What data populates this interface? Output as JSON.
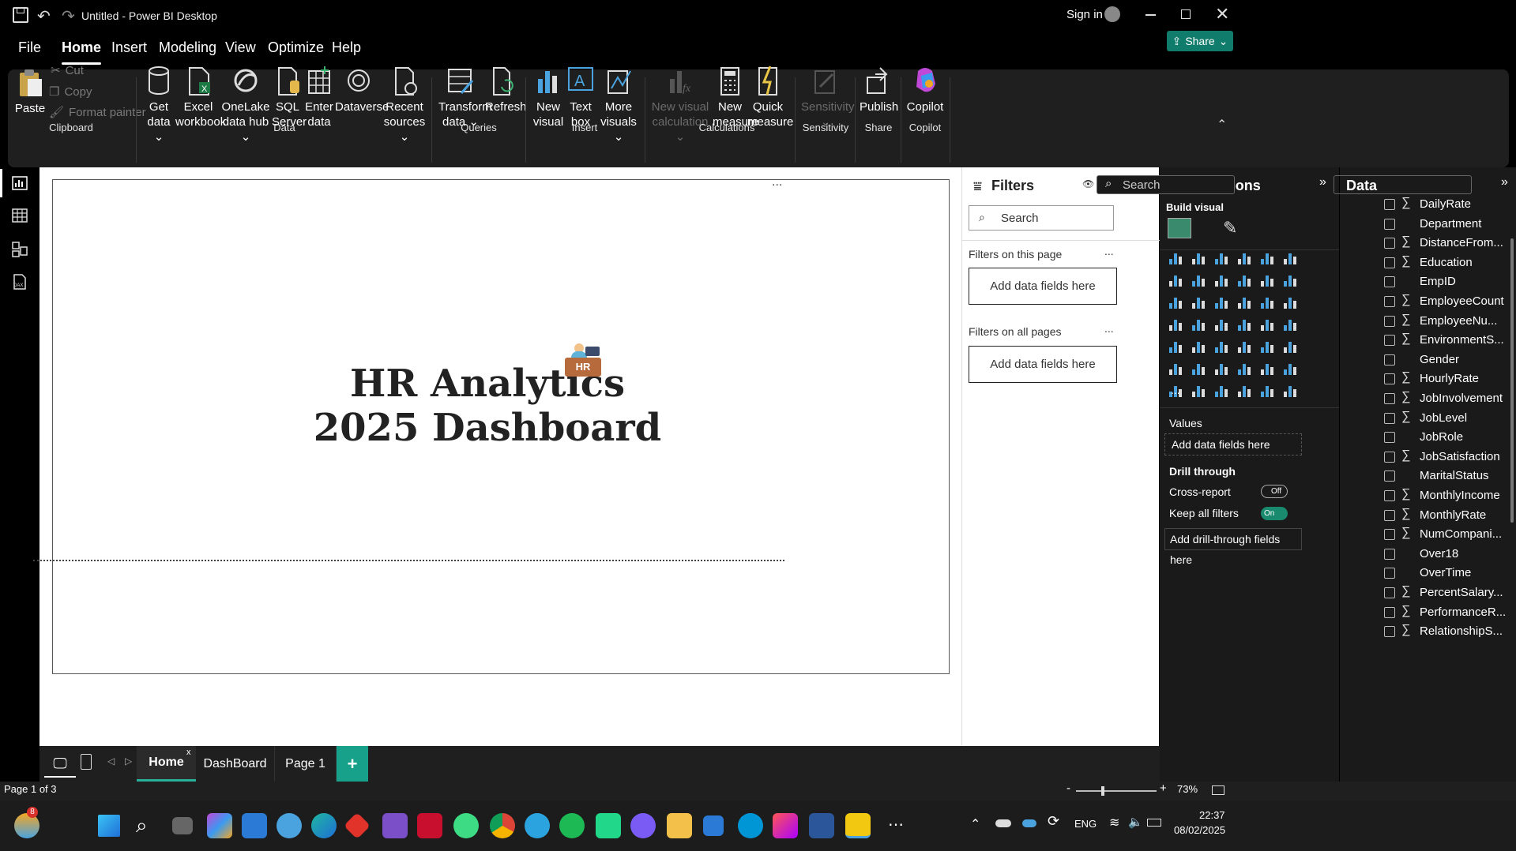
{
  "window": {
    "title": "Untitled - Power BI Desktop",
    "sign_in": "Sign in",
    "share": "Share"
  },
  "menu": [
    "File",
    "Home",
    "Insert",
    "Modeling",
    "View",
    "Optimize",
    "Help"
  ],
  "ribbon": {
    "clipboard": {
      "paste": "Paste",
      "cut": "Cut",
      "copy": "Copy",
      "format_painter": "Format painter",
      "label": "Clipboard"
    },
    "data": {
      "get_data": [
        "Get",
        "data"
      ],
      "excel": [
        "Excel",
        "workbook"
      ],
      "onelake": [
        "OneLake",
        "data hub"
      ],
      "sql": [
        "SQL",
        "Server"
      ],
      "enter": [
        "Enter",
        "data"
      ],
      "dataverse": "Dataverse",
      "recent": [
        "Recent",
        "sources"
      ],
      "label": "Data"
    },
    "queries": {
      "transform": [
        "Transform",
        "data"
      ],
      "refresh": "Refresh",
      "label": "Queries"
    },
    "insert": {
      "new_visual": [
        "New",
        "visual"
      ],
      "text_box": [
        "Text",
        "box"
      ],
      "more_visuals": [
        "More",
        "visuals"
      ],
      "label": "Insert"
    },
    "calculations": {
      "new_visual_calc": [
        "New visual",
        "calculation"
      ],
      "new_measure": [
        "New",
        "measure"
      ],
      "quick_measure": [
        "Quick",
        "measure"
      ],
      "label": "Calculations"
    },
    "sensitivity": {
      "btn": "Sensitivity",
      "label": "Sensitivity"
    },
    "share": {
      "publish": "Publish",
      "label": "Share"
    },
    "copilot": {
      "btn": "Copilot",
      "label": "Copilot"
    }
  },
  "canvas": {
    "title_line1": "HR Analytics",
    "title_line2": "2025 Dashboard",
    "more": "...",
    "badge": "HR"
  },
  "page_tabs": [
    "Home",
    "DashBoard",
    "Page 1"
  ],
  "status": {
    "page": "Page 1 of 3",
    "zoom": "73%"
  },
  "filters": {
    "title": "Filters",
    "search_placeholder": "Search",
    "on_page": "Filters on this page",
    "on_all": "Filters on all pages",
    "add": "Add data fields here",
    "more": "..."
  },
  "visualizations": {
    "title": "Visualizations",
    "build": "Build visual",
    "values": "Values",
    "values_add": "Add data fields here",
    "drill": "Drill through",
    "cross_report": "Cross-report",
    "cross_state": "Off",
    "keep_filters": "Keep all filters",
    "keep_state": "On",
    "drill_add": "Add drill-through fields here",
    "more": "..."
  },
  "data_pane": {
    "title": "Data",
    "search_placeholder": "Search",
    "fields": [
      {
        "name": "DailyRate",
        "sigma": true
      },
      {
        "name": "Department",
        "sigma": false
      },
      {
        "name": "DistanceFrom...",
        "sigma": true
      },
      {
        "name": "Education",
        "sigma": true
      },
      {
        "name": "EmpID",
        "sigma": false
      },
      {
        "name": "EmployeeCount",
        "sigma": true
      },
      {
        "name": "EmployeeNu...",
        "sigma": true
      },
      {
        "name": "EnvironmentS...",
        "sigma": true
      },
      {
        "name": "Gender",
        "sigma": false
      },
      {
        "name": "HourlyRate",
        "sigma": true
      },
      {
        "name": "JobInvolvement",
        "sigma": true
      },
      {
        "name": "JobLevel",
        "sigma": true
      },
      {
        "name": "JobRole",
        "sigma": false
      },
      {
        "name": "JobSatisfaction",
        "sigma": true
      },
      {
        "name": "MaritalStatus",
        "sigma": false
      },
      {
        "name": "MonthlyIncome",
        "sigma": true
      },
      {
        "name": "MonthlyRate",
        "sigma": true
      },
      {
        "name": "NumCompani...",
        "sigma": true
      },
      {
        "name": "Over18",
        "sigma": false
      },
      {
        "name": "OverTime",
        "sigma": false
      },
      {
        "name": "PercentSalary...",
        "sigma": true
      },
      {
        "name": "PerformanceR...",
        "sigma": true
      },
      {
        "name": "RelationshipS...",
        "sigma": true
      }
    ]
  },
  "taskbar": {
    "time": "22:37",
    "date": "08/02/2025",
    "lang": "ENG",
    "weather_badge": "8"
  },
  "sigma_char": "∑"
}
